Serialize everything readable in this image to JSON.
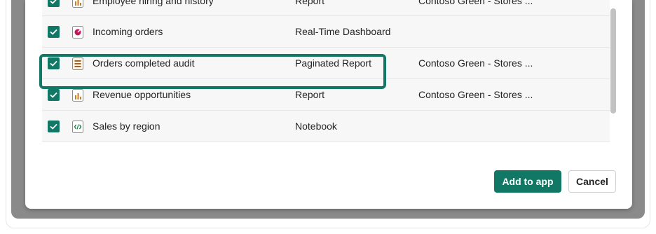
{
  "items": [
    {
      "name": "Employee hiring and history",
      "type": "Report",
      "workspace": "Contoso Green - Stores ...",
      "icon": "report-icon",
      "checked": true
    },
    {
      "name": "Incoming orders",
      "type": "Real-Time Dashboard",
      "workspace": "",
      "icon": "realtime-dashboard-icon",
      "checked": true
    },
    {
      "name": "Orders completed audit",
      "type": "Paginated Report",
      "workspace": "Contoso Green - Stores ...",
      "icon": "paginated-report-icon",
      "checked": true
    },
    {
      "name": "Revenue opportunities",
      "type": "Report",
      "workspace": "Contoso Green - Stores ...",
      "icon": "report-icon",
      "checked": true
    },
    {
      "name": "Sales by region",
      "type": "Notebook",
      "workspace": "",
      "icon": "notebook-icon",
      "checked": true
    }
  ],
  "buttons": {
    "add_label": "Add to app",
    "cancel_label": "Cancel"
  },
  "colors": {
    "accent": "#117865",
    "highlight": "#117865"
  }
}
